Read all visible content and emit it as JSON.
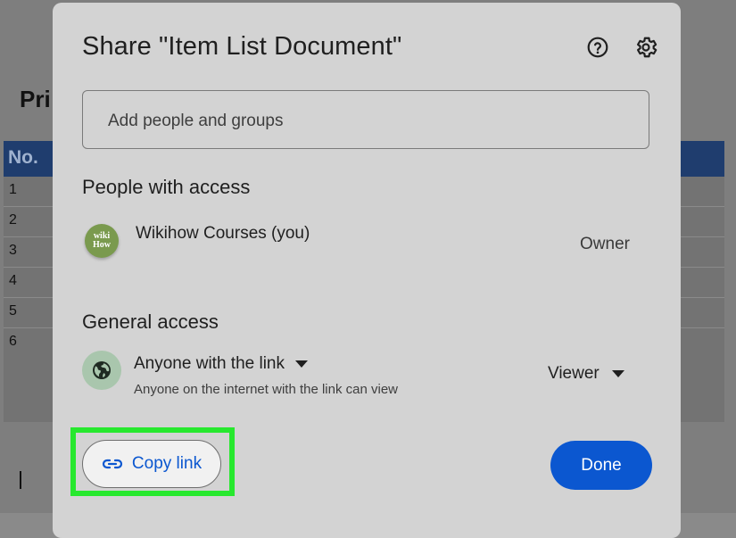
{
  "background_doc": {
    "title_partial": "Pri",
    "table_header": "No.",
    "row_numbers": [
      "1",
      "2",
      "3",
      "4",
      "5",
      "6"
    ]
  },
  "dialog": {
    "title": "Share \"Item List Document\"",
    "help_icon": "help-circle-icon",
    "settings_icon": "gear-icon",
    "add_people_placeholder": "Add people and groups",
    "people_section_heading": "People with access",
    "people": [
      {
        "name": "Wikihow Courses (you)",
        "avatar_text_top": "wiki",
        "avatar_text_bottom": "How",
        "role": "Owner"
      }
    ],
    "general_access_heading": "General access",
    "general_access": {
      "icon": "globe-icon",
      "selected": "Anyone with the link",
      "description": "Anyone on the internet with the link can view",
      "role": "Viewer"
    },
    "copy_link_label": "Copy link",
    "done_label": "Done"
  },
  "colors": {
    "accent_blue": "#0b57d0",
    "highlight_green": "#27e82e",
    "dialog_bg": "#d3d3d3"
  }
}
